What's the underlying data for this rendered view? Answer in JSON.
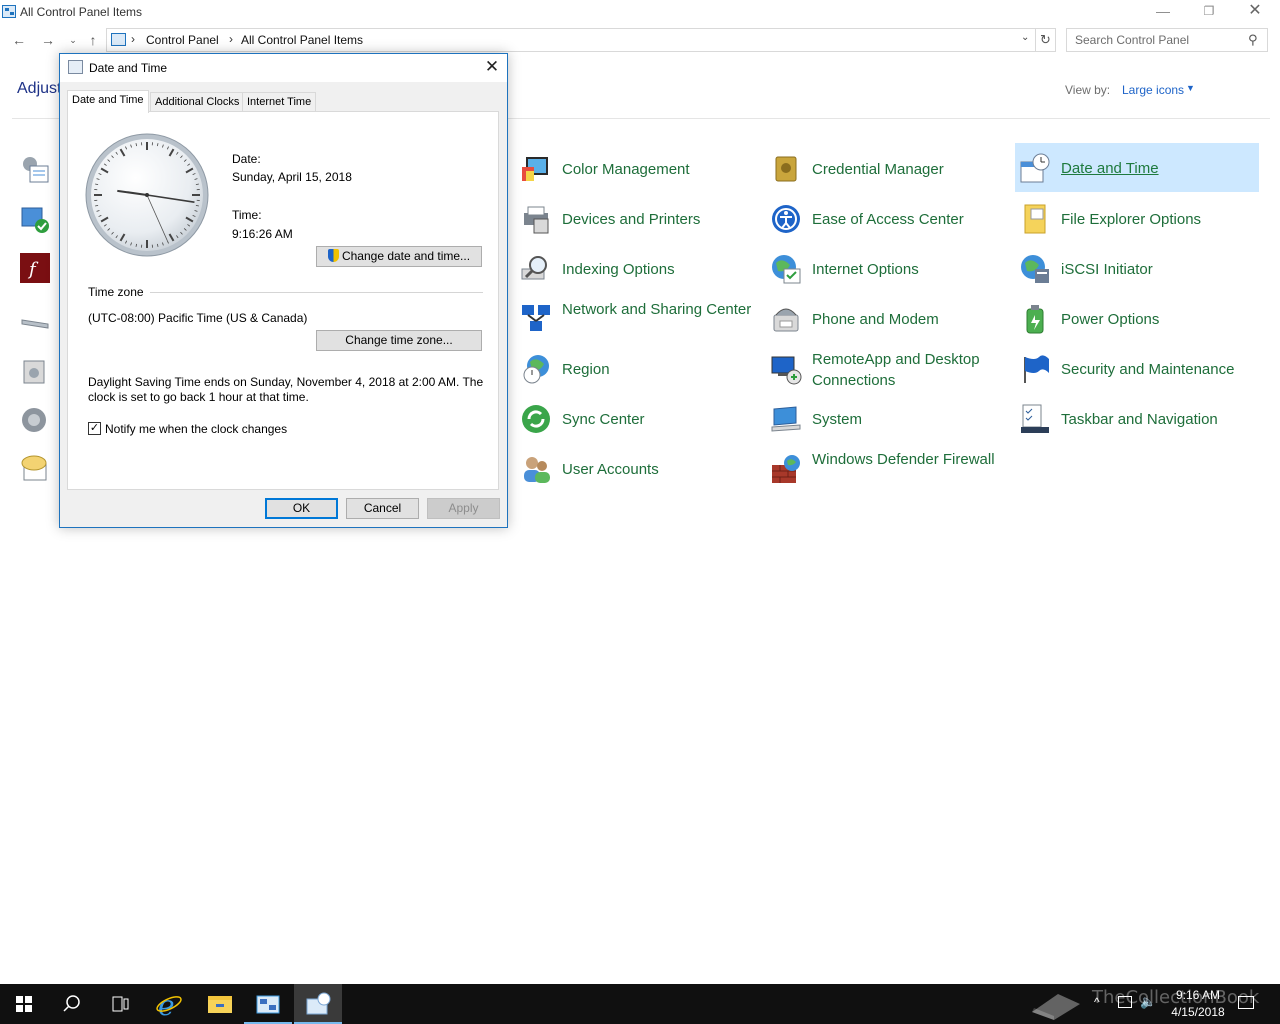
{
  "window": {
    "title": "All Control Panel Items",
    "controls": {
      "minimize": "—",
      "maximize": "❐",
      "close": "✕"
    }
  },
  "address": {
    "crumbs": [
      "Control Panel",
      "All Control Panel Items"
    ],
    "search_placeholder": "Search Control Panel"
  },
  "header": {
    "adjust_text": "Adjust",
    "view_by_label": "View by:",
    "view_by_value": "Large icons"
  },
  "items": [
    {
      "label": "Color Management",
      "icon": "color-management-icon"
    },
    {
      "label": "Credential Manager",
      "icon": "credential-manager-icon"
    },
    {
      "label": "Date and Time",
      "icon": "date-time-icon",
      "selected": true
    },
    {
      "label": "Devices and Printers",
      "icon": "devices-printers-icon"
    },
    {
      "label": "Ease of Access Center",
      "icon": "ease-of-access-icon"
    },
    {
      "label": "File Explorer Options",
      "icon": "folder-options-icon"
    },
    {
      "label": "Indexing Options",
      "icon": "indexing-icon"
    },
    {
      "label": "Internet Options",
      "icon": "internet-options-icon"
    },
    {
      "label": "iSCSI Initiator",
      "icon": "iscsi-icon"
    },
    {
      "label": "Network and Sharing Center",
      "icon": "network-icon"
    },
    {
      "label": "Phone and Modem",
      "icon": "phone-modem-icon"
    },
    {
      "label": "Power Options",
      "icon": "power-icon"
    },
    {
      "label": "Region",
      "icon": "region-icon"
    },
    {
      "label": "RemoteApp and Desktop Connections",
      "icon": "remoteapp-icon"
    },
    {
      "label": "Security and Maintenance",
      "icon": "flag-icon"
    },
    {
      "label": "Sync Center",
      "icon": "sync-icon"
    },
    {
      "label": "System",
      "icon": "system-icon"
    },
    {
      "label": "Taskbar and Navigation",
      "icon": "taskbar-icon"
    },
    {
      "label": "User Accounts",
      "icon": "users-icon"
    },
    {
      "label": "Windows Defender Firewall",
      "icon": "firewall-icon"
    }
  ],
  "dialog": {
    "title": "Date and Time",
    "tabs": [
      "Date and Time",
      "Additional Clocks",
      "Internet Time"
    ],
    "date_label": "Date:",
    "date_value": "Sunday, April 15, 2018",
    "time_label": "Time:",
    "time_value": "9:16:26 AM",
    "change_datetime_btn": "Change date and time...",
    "timezone_header": "Time zone",
    "timezone_value": "(UTC-08:00) Pacific Time (US & Canada)",
    "change_timezone_btn": "Change time zone...",
    "dst_text": "Daylight Saving Time ends on Sunday, November 4, 2018 at 2:00 AM. The clock is set to go back 1 hour at that time.",
    "notify_label": "Notify me when the clock changes",
    "notify_checked": true,
    "ok": "OK",
    "cancel": "Cancel",
    "apply": "Apply",
    "clock": {
      "hour": 9,
      "minute": 16,
      "second": 26
    }
  },
  "taskbar": {
    "time": "9:16 AM",
    "date": "4/15/2018",
    "watermark": "TheCollectionBook"
  }
}
